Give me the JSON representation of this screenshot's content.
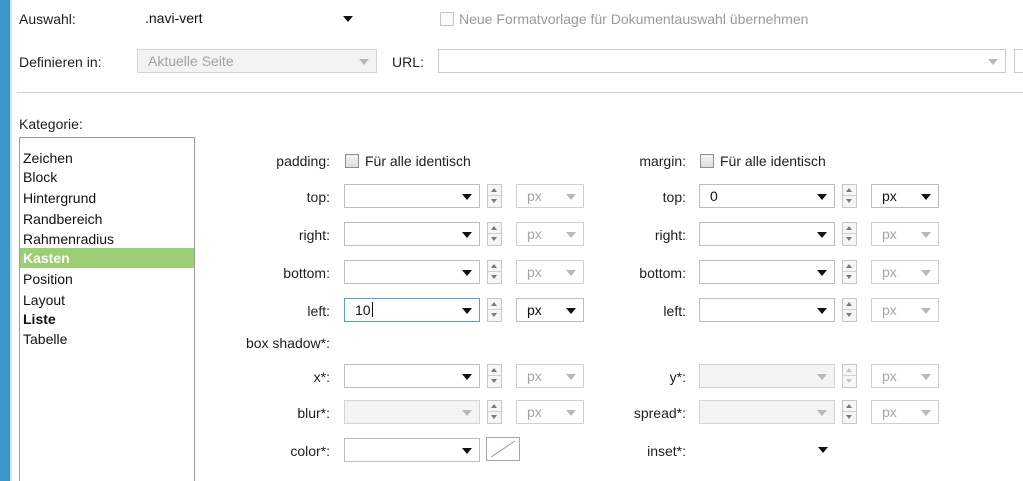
{
  "top": {
    "selection_label": "Auswahl:",
    "selection_value": ".navi-vert",
    "new_style_checkbox_label": "Neue Formatvorlage für Dokumentauswahl übernehmen",
    "define_in_label": "Definieren in:",
    "define_in_value": "Aktuelle Seite",
    "url_label": "URL:",
    "url_value": ""
  },
  "category": {
    "label": "Kategorie:",
    "items": [
      {
        "label": "Zeichen"
      },
      {
        "label": "Block"
      },
      {
        "label": "Hintergrund"
      },
      {
        "label": "Randbereich"
      },
      {
        "label": "Rahmenradius"
      },
      {
        "label": "Kasten",
        "selected": true
      },
      {
        "label": "Position"
      },
      {
        "label": "Layout"
      },
      {
        "label": "Liste"
      },
      {
        "label": "Tabelle"
      }
    ]
  },
  "padding": {
    "label": "padding:",
    "same_for_all_label": "Für alle identisch",
    "top": {
      "label": "top:",
      "value": "",
      "unit": "px"
    },
    "right": {
      "label": "right:",
      "value": "",
      "unit": "px"
    },
    "bottom": {
      "label": "bottom:",
      "value": "",
      "unit": "px"
    },
    "left": {
      "label": "left:",
      "value": "10",
      "unit": "px"
    }
  },
  "margin": {
    "label": "margin:",
    "same_for_all_label": "Für alle identisch",
    "top": {
      "label": "top:",
      "value": "0",
      "unit": "px"
    },
    "right": {
      "label": "right:",
      "value": "",
      "unit": "px"
    },
    "bottom": {
      "label": "bottom:",
      "value": "",
      "unit": "px"
    },
    "left": {
      "label": "left:",
      "value": "",
      "unit": "px"
    }
  },
  "box_shadow": {
    "label": "box shadow*:",
    "x": {
      "label": "x*:",
      "value": "",
      "unit": "px"
    },
    "y": {
      "label": "y*:",
      "value": "",
      "unit": "px"
    },
    "blur": {
      "label": "blur*:",
      "value": "",
      "unit": "px"
    },
    "spread": {
      "label": "spread*:",
      "value": "",
      "unit": "px"
    },
    "color": {
      "label": "color*:",
      "value": ""
    },
    "inset": {
      "label": "inset*:",
      "value": ""
    }
  },
  "colors": {
    "accent": "#3a97cc",
    "selected_category": "#9ccf73"
  }
}
